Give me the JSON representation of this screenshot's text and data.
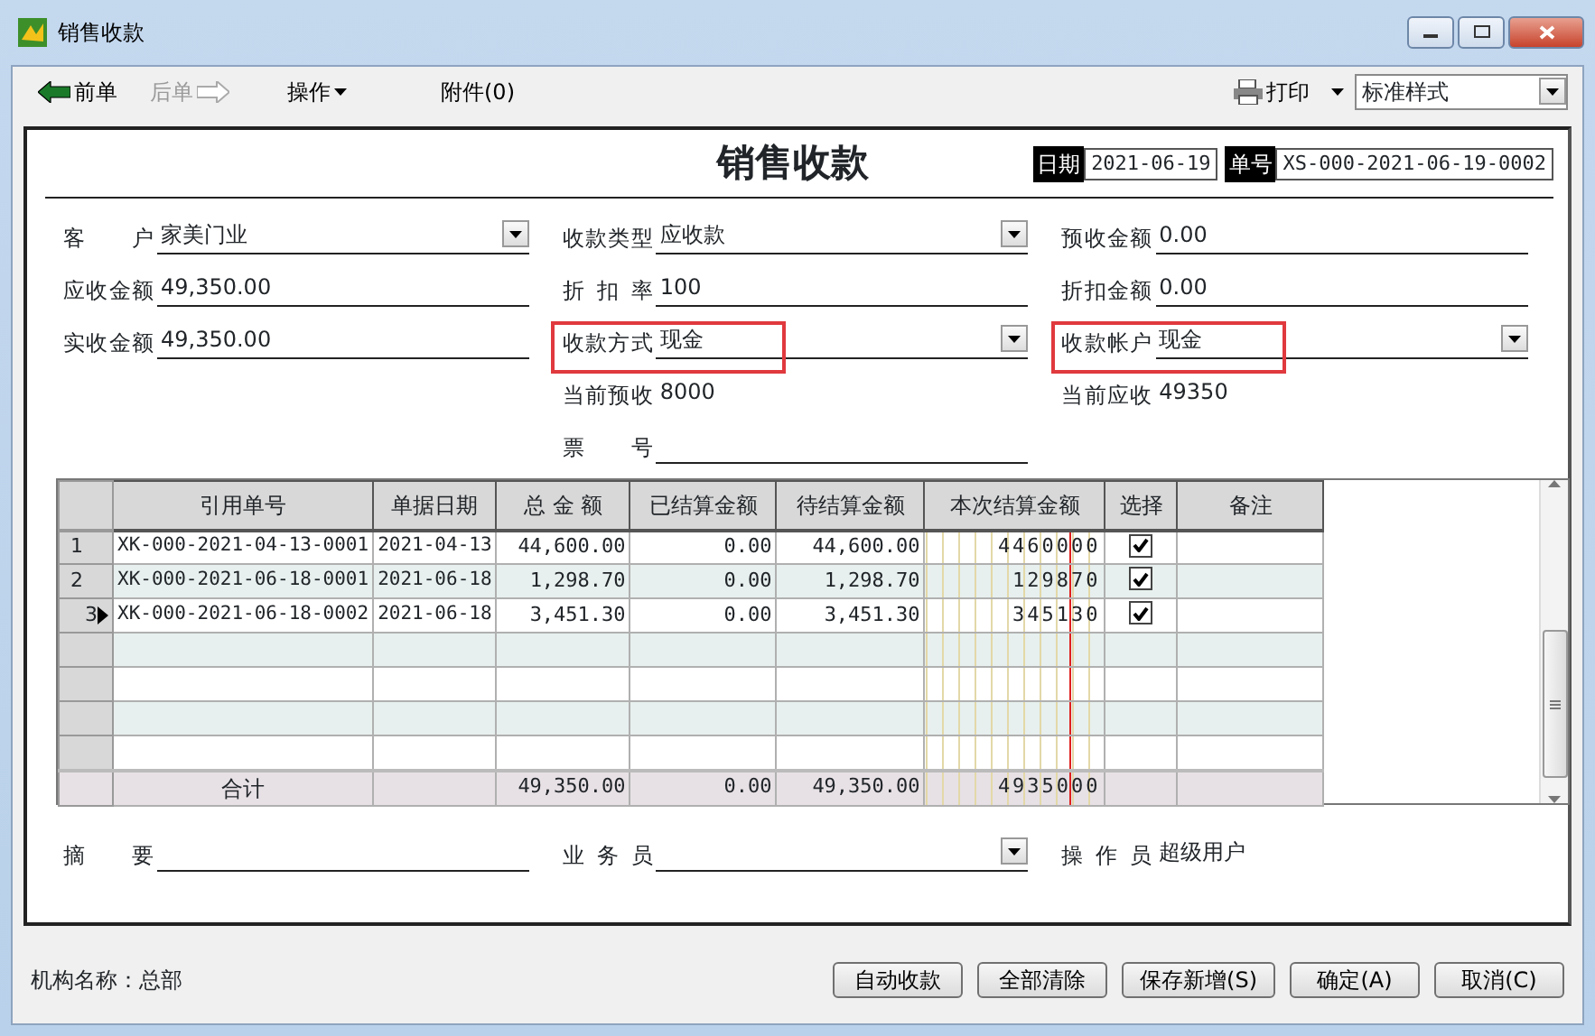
{
  "window": {
    "title": "销售收款"
  },
  "toolbar": {
    "items": [
      {
        "label": "前单",
        "kind": "prev",
        "disabled": false
      },
      {
        "label": "后单",
        "kind": "next",
        "disabled": true
      },
      {
        "label": "操作",
        "kind": "menu",
        "disabled": false
      },
      {
        "label": "附件(0)",
        "kind": "plain",
        "disabled": false
      }
    ],
    "print": "打印",
    "style_select": "标准样式"
  },
  "form": {
    "title": "销售收款",
    "date_label": "日期",
    "date": "2021-06-19",
    "number_label": "单号",
    "number": "XS-000-2021-06-19-0002",
    "columns": [
      [
        {
          "label": "客 户",
          "value": "家美门业",
          "kind": "dropdown",
          "highlighted": false
        },
        {
          "label": "应收金额",
          "value": "49,350.00",
          "kind": "line",
          "highlighted": false
        },
        {
          "label": "实收金额",
          "value": "49,350.00",
          "kind": "line",
          "highlighted": false
        }
      ],
      [
        {
          "label": "收款类型",
          "value": "应收款",
          "kind": "dropdown",
          "highlighted": false
        },
        {
          "label": "折 扣 率",
          "value": "100",
          "kind": "line",
          "highlighted": false
        },
        {
          "label": "收款方式",
          "value": "现金",
          "kind": "dropdown",
          "highlighted": true
        },
        {
          "label": "当前预收",
          "value": "8000",
          "kind": "plain",
          "highlighted": false
        },
        {
          "label": "票 号",
          "kind": "line",
          "highlighted": false
        }
      ],
      [
        {
          "label": "预收金额",
          "value": "0.00",
          "kind": "line",
          "highlighted": false
        },
        {
          "label": "折扣金额",
          "value": "0.00",
          "kind": "line",
          "highlighted": false
        },
        {
          "label": "收款帐户",
          "value": "现金",
          "kind": "dropdown",
          "highlighted": true
        },
        {
          "label": "当前应收",
          "value": "49350",
          "kind": "plain",
          "highlighted": false
        }
      ]
    ]
  },
  "grid": {
    "columns": [
      "引用单号",
      "单据日期",
      "总 金 额",
      "已结算金额",
      "待结算金额",
      "本次结算金额",
      "选择",
      "备注"
    ],
    "rows": [
      {
        "row_number": "1",
        "current": false,
        "ref": "XK-000-2021-04-13-0001",
        "date": "2021-04-13",
        "total": "44,600.00",
        "settled": "0.00",
        "pending": "44,600.00",
        "settle": "4460000",
        "checked": true
      },
      {
        "row_number": "2",
        "current": false,
        "ref": "XK-000-2021-06-18-0001",
        "date": "2021-06-18",
        "total": "1,298.70",
        "settled": "0.00",
        "pending": "1,298.70",
        "settle": "129870",
        "checked": true
      },
      {
        "row_number": "3",
        "current": true,
        "ref": "XK-000-2021-06-18-0002",
        "date": "2021-06-18",
        "total": "3,451.30",
        "settled": "0.00",
        "pending": "3,451.30",
        "settle": "345130",
        "checked": true
      }
    ],
    "total_row": {
      "label": "合计",
      "total": "49,350.00",
      "settled": "0.00",
      "pending": "49,350.00",
      "settle": "4935000"
    }
  },
  "footer_fields": [
    {
      "label": "摘要",
      "kind": "line",
      "highlighted": false
    },
    {
      "label": "业务员",
      "kind": "dropdown",
      "highlighted": false
    },
    {
      "label": "操作员",
      "value": "超级用户",
      "kind": "plain",
      "highlighted": false
    }
  ],
  "status": {
    "org": "机构名称：总部",
    "buttons": [
      "自动收款",
      "全部清除",
      "保存新增(S)",
      "确定(A)",
      "取消(C)"
    ]
  }
}
